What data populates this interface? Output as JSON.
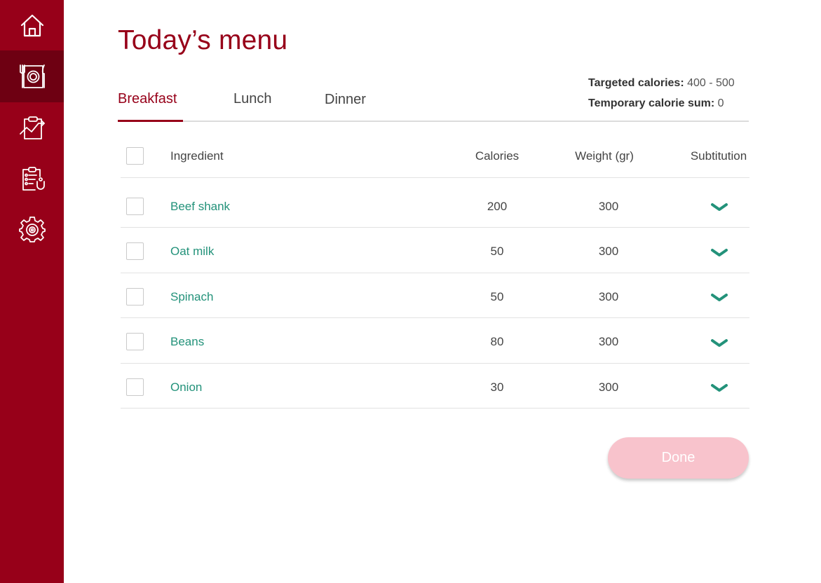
{
  "sidebar": {
    "items": [
      {
        "icon": "home-icon"
      },
      {
        "icon": "menu-plate-icon",
        "active": true
      },
      {
        "icon": "progress-chart-icon"
      },
      {
        "icon": "health-report-icon"
      },
      {
        "icon": "settings-gear-icon"
      }
    ]
  },
  "page_title": "Today’s menu",
  "tabs": [
    {
      "label": "Breakfast",
      "active": true
    },
    {
      "label": "Lunch"
    },
    {
      "label": "Dinner"
    }
  ],
  "calories": {
    "targeted_label": "Targeted calories:",
    "targeted_value": "400 - 500",
    "temp_label": "Temporary calorie sum:",
    "temp_value": "0"
  },
  "table": {
    "headers": {
      "ingredient": "Ingredient",
      "calories": "Calories",
      "weight": "Weight (gr)",
      "substitution": "Subtitution"
    },
    "rows": [
      {
        "ingredient": "Beef shank",
        "calories": "200",
        "weight": "300"
      },
      {
        "ingredient": "Oat milk",
        "calories": "50",
        "weight": "300"
      },
      {
        "ingredient": "Spinach",
        "calories": "50",
        "weight": "300"
      },
      {
        "ingredient": "Beans",
        "calories": "80",
        "weight": "300"
      },
      {
        "ingredient": "Onion",
        "calories": "30",
        "weight": "300"
      }
    ]
  },
  "done_label": "Done",
  "colors": {
    "brand": "#970019",
    "brand_dark": "#6e0012",
    "accent_green": "#23927a",
    "done_disabled": "#f8c3cc"
  }
}
